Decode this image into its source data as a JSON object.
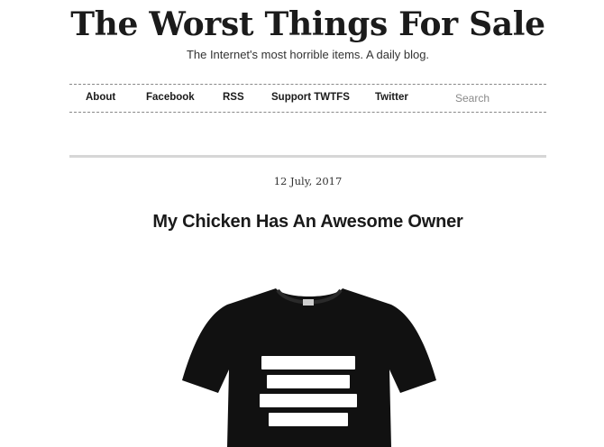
{
  "site": {
    "title": "The Worst Things For Sale",
    "tagline": "The Internet's most horrible items. A daily blog."
  },
  "nav": {
    "items": [
      {
        "label": "About"
      },
      {
        "label": "Facebook"
      },
      {
        "label": "RSS"
      },
      {
        "label": "Support TWTFS"
      },
      {
        "label": "Twitter"
      }
    ],
    "search": {
      "placeholder": "Search",
      "value": ""
    }
  },
  "post": {
    "date": "12 July, 2017",
    "title": "My Chicken Has An Awesome Owner"
  },
  "colors": {
    "text": "#1a1a1a",
    "divider": "#d6d6d6",
    "shirt": "#111111",
    "shirt_print": "#ffffff"
  }
}
